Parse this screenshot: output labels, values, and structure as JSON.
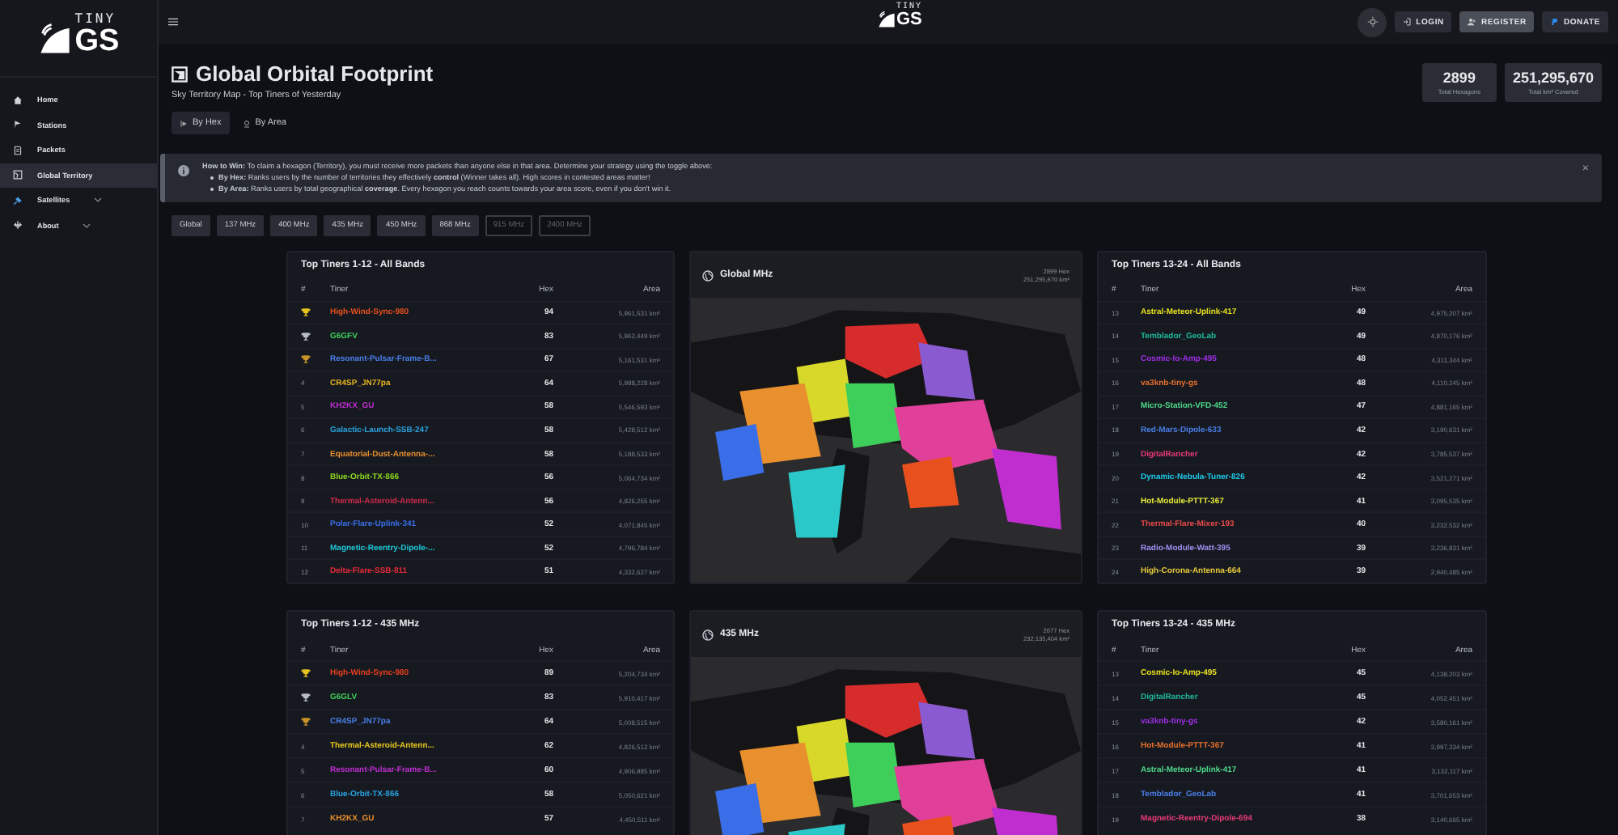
{
  "logo": {
    "top": "TINY",
    "bottom": "GS"
  },
  "sidebar": {
    "items": [
      {
        "label": "Home",
        "selected": false,
        "expandable": false
      },
      {
        "label": "Stations",
        "selected": false,
        "expandable": false
      },
      {
        "label": "Packets",
        "selected": false,
        "expandable": false
      },
      {
        "label": "Global Territory",
        "selected": true,
        "expandable": false
      },
      {
        "label": "Satellites",
        "selected": false,
        "expandable": true
      },
      {
        "label": "About",
        "selected": false,
        "expandable": true
      }
    ]
  },
  "header": {
    "logo": {
      "top": "TINY",
      "bottom": "GS"
    },
    "login": "LOGIN",
    "register": "REGISTER",
    "donate": "DONATE"
  },
  "page": {
    "title": "Global Orbital Footprint",
    "subtitle": "Sky Territory Map - Top Tiners of Yesterday"
  },
  "modes": [
    {
      "label": "By Hex",
      "selected": true
    },
    {
      "label": "By Area",
      "selected": false
    }
  ],
  "stats": [
    {
      "value": "2899",
      "label": "Total Hexagons"
    },
    {
      "value": "251,295,670",
      "label": "Total km² Covered"
    }
  ],
  "alert": {
    "text": "**How to Win:** To claim a hexagon (Territory), you must receive more packets than anyone else in that area. Determine your strategy using the toggle above:",
    "close": "×",
    "bullets": [
      "**By Hex:** Ranks users by the number of territories they effectively **control** (Winner takes all). High scores in contested areas matter!",
      "**By Area:** Ranks users by total geographical **coverage**. Every hexagon you reach counts towards your area score, even if you don't win it."
    ]
  },
  "bands": [
    {
      "label": "Global",
      "disabled": false
    },
    {
      "label": "137 MHz",
      "disabled": false
    },
    {
      "label": "400 MHz",
      "disabled": false
    },
    {
      "label": "435 MHz",
      "disabled": false
    },
    {
      "label": "450 MHz",
      "disabled": false
    },
    {
      "label": "868 MHz",
      "disabled": false
    },
    {
      "label": "915 MHz",
      "disabled": true
    },
    {
      "label": "2400 MHz",
      "disabled": true
    }
  ],
  "sections": [
    {
      "left": {
        "title": "Top Tiners 1-12 - All Bands",
        "columns": [
          "#",
          "Tiner",
          "Hex",
          "Area"
        ],
        "rows": [
          {
            "kind": "trophy",
            "name": "High-Wind-Sync-980",
            "hex": "94",
            "area": "5,961,531 km²",
            "color": "#e8501e"
          },
          {
            "kind": "trophy",
            "name": "G6GFV",
            "hex": "83",
            "area": "5,962,449 km²",
            "color": "#3ecf5a"
          },
          {
            "kind": "trophy",
            "name": "Resonant-Pulsar-Frame-B...",
            "hex": "67",
            "area": "5,161,531 km²",
            "color": "#4a7ee8"
          },
          {
            "kind": "rank",
            "rank": "4",
            "name": "CR4SP_JN77pa",
            "hex": "64",
            "area": "5,988,228 km²",
            "color": "#e8b51e"
          },
          {
            "kind": "rank",
            "rank": "5",
            "name": "KH2KX_GU",
            "hex": "58",
            "area": "5,546,593 km²",
            "color": "#c02ed0"
          },
          {
            "kind": "rank",
            "rank": "6",
            "name": "Galactic-Launch-SSB-247",
            "hex": "58",
            "area": "5,428,512 km²",
            "color": "#2aa3e0"
          },
          {
            "kind": "rank",
            "rank": "7",
            "name": "Equatorial-Dust-Antenna-...",
            "hex": "58",
            "area": "5,188,533 km²",
            "color": "#e8902e"
          },
          {
            "kind": "rank",
            "rank": "8",
            "name": "Blue-Orbit-TX-866",
            "hex": "56",
            "area": "5,064,734 km²",
            "color": "#8ed81e"
          },
          {
            "kind": "rank",
            "rank": "9",
            "name": "Thermal-Asteroid-Antenn...",
            "hex": "56",
            "area": "4,826,255 km²",
            "color": "#d02a4a"
          },
          {
            "kind": "rank",
            "rank": "10",
            "name": "Polar-Flare-Uplink-341",
            "hex": "52",
            "area": "4,071,845 km²",
            "color": "#3a6ee8"
          },
          {
            "kind": "rank",
            "rank": "11",
            "name": "Magnetic-Reentry-Dipole-...",
            "hex": "52",
            "area": "4,796,784 km²",
            "color": "#1ec8d8"
          },
          {
            "kind": "rank",
            "rank": "12",
            "name": "Delta-Flare-SSB-811",
            "hex": "51",
            "area": "4,332,627 km²",
            "color": "#e82a3a"
          }
        ]
      },
      "map": {
        "title": "Global MHz",
        "hex": "2899 Hex",
        "area": "251,295,670 km²"
      },
      "right": {
        "title": "Top Tiners 13-24 - All Bands",
        "columns": [
          "#",
          "Tiner",
          "Hex",
          "Area"
        ],
        "rows": [
          {
            "kind": "rank",
            "rank": "13",
            "name": "Astral-Meteor-Uplink-417",
            "hex": "49",
            "area": "4,975,207 km²",
            "color": "#e8e01e"
          },
          {
            "kind": "rank",
            "rank": "14",
            "name": "Temblador_GeoLab",
            "hex": "49",
            "area": "4,870,176 km²",
            "color": "#1eb89a"
          },
          {
            "kind": "rank",
            "rank": "15",
            "name": "Cosmic-Io-Amp-495",
            "hex": "48",
            "area": "4,311,344 km²",
            "color": "#a02ee8"
          },
          {
            "kind": "rank",
            "rank": "16",
            "name": "va3knb-tiny-gs",
            "hex": "48",
            "area": "4,110,245 km²",
            "color": "#e8702e"
          },
          {
            "kind": "rank",
            "rank": "17",
            "name": "Micro-Station-VFD-452",
            "hex": "47",
            "area": "4,881,165 km²",
            "color": "#4ed88a"
          },
          {
            "kind": "rank",
            "rank": "18",
            "name": "Red-Mars-Dipole-633",
            "hex": "42",
            "area": "3,190,631 km²",
            "color": "#4a7ee8"
          },
          {
            "kind": "rank",
            "rank": "19",
            "name": "DigitalRancher",
            "hex": "42",
            "area": "3,785,537 km²",
            "color": "#e83a7a"
          },
          {
            "kind": "rank",
            "rank": "20",
            "name": "Dynamic-Nebula-Tuner-826",
            "hex": "42",
            "area": "3,521,271 km²",
            "color": "#1ec8e8"
          },
          {
            "kind": "rank",
            "rank": "21",
            "name": "Hot-Module-PTTT-367",
            "hex": "41",
            "area": "3,095,535 km²",
            "color": "#e8e83a"
          },
          {
            "kind": "rank",
            "rank": "22",
            "name": "Thermal-Flare-Mixer-193",
            "hex": "40",
            "area": "3,232,532 km²",
            "color": "#e84a4a"
          },
          {
            "kind": "rank",
            "rank": "23",
            "name": "Radio-Module-Watt-395",
            "hex": "39",
            "area": "3,236,831 km²",
            "color": "#a08ef0"
          },
          {
            "kind": "rank",
            "rank": "24",
            "name": "High-Corona-Antenna-664",
            "hex": "39",
            "area": "2,940,485 km²",
            "color": "#e8c83a"
          }
        ]
      }
    },
    {
      "left": {
        "title": "Top Tiners 1-12 - 435 MHz",
        "columns": [
          "#",
          "Tiner",
          "Hex",
          "Area"
        ],
        "rows": [
          {
            "kind": "trophy",
            "name": "High-Wind-Sync-980",
            "hex": "89",
            "area": "5,204,734 km²",
            "color": "#e8401e"
          },
          {
            "kind": "trophy",
            "name": "G6GLV",
            "hex": "83",
            "area": "5,910,417 km²",
            "color": "#3ecf5a"
          },
          {
            "kind": "trophy",
            "name": "CR4SP_JN77pa",
            "hex": "64",
            "area": "5,008,515 km²",
            "color": "#4a7ee8"
          },
          {
            "kind": "rank",
            "rank": "4",
            "name": "Thermal-Asteroid-Antenn...",
            "hex": "62",
            "area": "4,826,512 km²",
            "color": "#e8c81e"
          },
          {
            "kind": "rank",
            "rank": "5",
            "name": "Resonant-Pulsar-Frame-B...",
            "hex": "60",
            "area": "4,906,985 km²",
            "color": "#c02ed0"
          },
          {
            "kind": "rank",
            "rank": "6",
            "name": "Blue-Orbit-TX-866",
            "hex": "58",
            "area": "5,050,621 km²",
            "color": "#2aa3e0"
          },
          {
            "kind": "rank",
            "rank": "7",
            "name": "KH2KX_GU",
            "hex": "57",
            "area": "4,450,511 km²",
            "color": "#e8902e"
          }
        ]
      },
      "map": {
        "title": "435 MHz",
        "hex": "2677 Hex",
        "area": "232,135,404 km²"
      },
      "right": {
        "title": "Top Tiners 13-24 - 435 MHz",
        "columns": [
          "#",
          "Tiner",
          "Hex",
          "Area"
        ],
        "rows": [
          {
            "kind": "rank",
            "rank": "13",
            "name": "Cosmic-Io-Amp-495",
            "hex": "45",
            "area": "4,138,203 km²",
            "color": "#e8e01e"
          },
          {
            "kind": "rank",
            "rank": "14",
            "name": "DigitalRancher",
            "hex": "45",
            "area": "4,052,451 km²",
            "color": "#1eb89a"
          },
          {
            "kind": "rank",
            "rank": "15",
            "name": "va3knb-tiny-gs",
            "hex": "42",
            "area": "3,580,161 km²",
            "color": "#a02ee8"
          },
          {
            "kind": "rank",
            "rank": "16",
            "name": "Hot-Module-PTTT-367",
            "hex": "41",
            "area": "3,997,334 km²",
            "color": "#e8702e"
          },
          {
            "kind": "rank",
            "rank": "17",
            "name": "Astral-Meteor-Uplink-417",
            "hex": "41",
            "area": "3,132,117 km²",
            "color": "#4ed88a"
          },
          {
            "kind": "rank",
            "rank": "18",
            "name": "Temblador_GeoLab",
            "hex": "41",
            "area": "3,701,653 km²",
            "color": "#4a7ee8"
          },
          {
            "kind": "rank",
            "rank": "19",
            "name": "Magnetic-Reentry-Dipole-694",
            "hex": "38",
            "area": "3,140,665 km²",
            "color": "#e83a7a"
          }
        ]
      }
    }
  ]
}
